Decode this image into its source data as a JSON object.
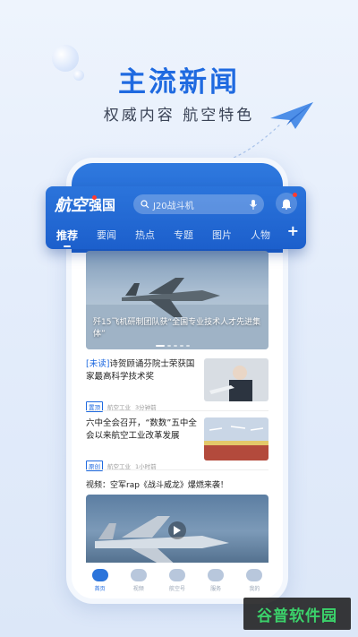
{
  "promo": {
    "headline": "主流新闻",
    "subline": "权威内容 航空特色"
  },
  "app": {
    "logo_main": "航空",
    "logo_sub": "强国",
    "search_placeholder": "J20战斗机",
    "tabs": [
      {
        "label": "推荐"
      },
      {
        "label": "要闻"
      },
      {
        "label": "热点"
      },
      {
        "label": "专题"
      },
      {
        "label": "图片"
      },
      {
        "label": "人物"
      }
    ],
    "add_tab": "+"
  },
  "feed": {
    "banner_caption": "歼15飞机研制团队获“全国专业技术人才先进集体”",
    "items": [
      {
        "tag": "[未读]",
        "title": "诗贺顾诵芬院士荣获国家最高科学技术奖",
        "badge": "置顶",
        "source": "航空工业",
        "time": "3分钟前"
      },
      {
        "tag": "",
        "title": "六中全会召开，“数数”五中全会以来航空工业改革发展",
        "badge": "原创",
        "source": "航空工业",
        "time": "1小时前"
      }
    ],
    "video_title": "视频：空军rap《战斗威龙》爆燃来袭！"
  },
  "bottom_nav": [
    {
      "label": "首页"
    },
    {
      "label": "视频"
    },
    {
      "label": "航空号"
    },
    {
      "label": "服务"
    },
    {
      "label": "我的"
    }
  ],
  "watermark": "谷普软件园",
  "colors": {
    "accent": "#1f6ae0",
    "header": "#2b74db",
    "watermark_text": "#3bd36b"
  }
}
